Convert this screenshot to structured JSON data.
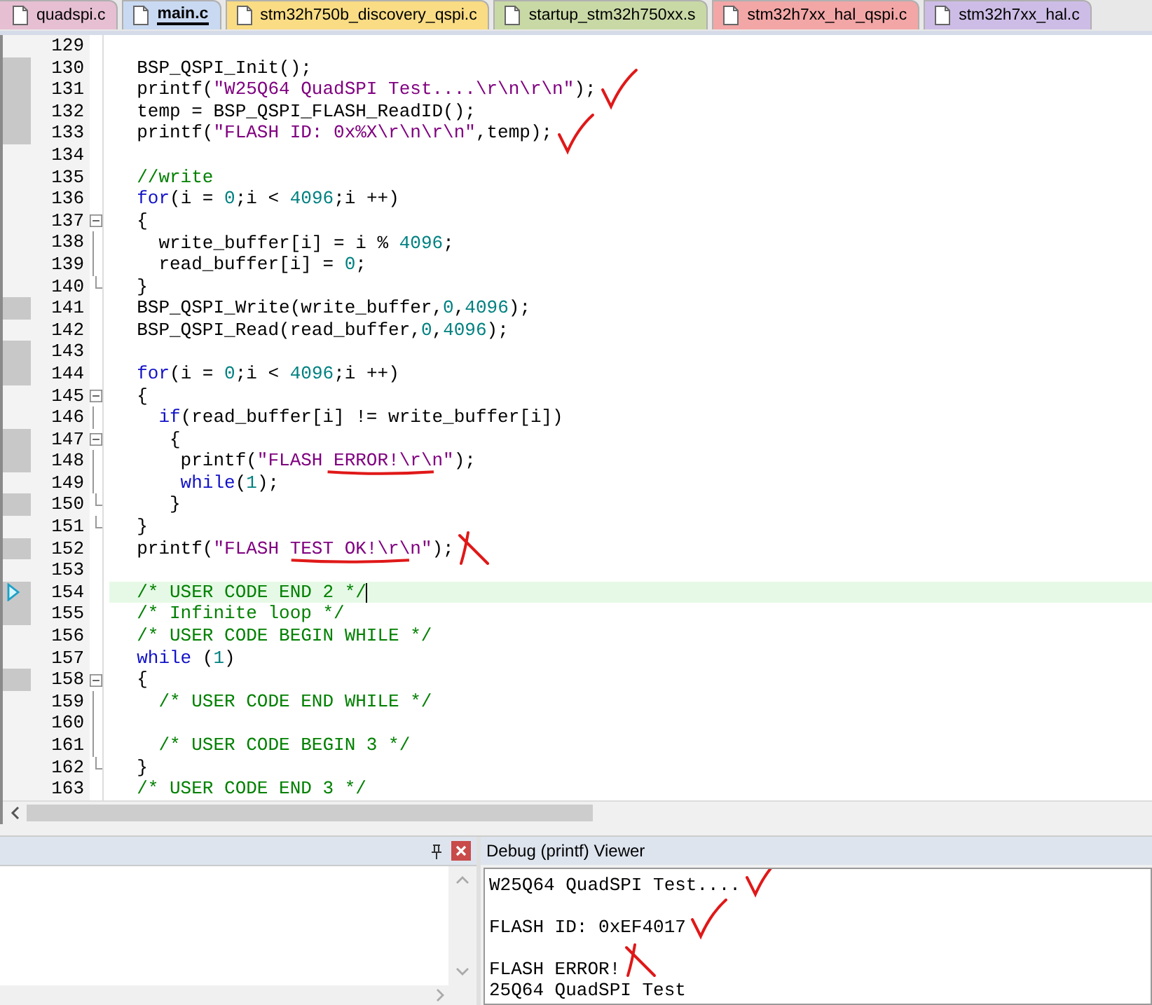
{
  "tabs": [
    {
      "label": "quadspi.c",
      "selected": false,
      "color": "#e6bfd2"
    },
    {
      "label": "main.c",
      "selected": true,
      "color": "#c9d9f2"
    },
    {
      "label": "stm32h750b_discovery_qspi.c",
      "selected": false,
      "color": "#f9dc84"
    },
    {
      "label": "startup_stm32h750xx.s",
      "selected": false,
      "color": "#c9d9a6"
    },
    {
      "label": "stm32h7xx_hal_qspi.c",
      "selected": false,
      "color": "#f2a6a6"
    },
    {
      "label": "stm32h7xx_hal.c",
      "selected": false,
      "color": "#cdbde6"
    }
  ],
  "editor": {
    "lines": [
      {
        "number": "129",
        "executable": false
      },
      {
        "number": "130",
        "executable": true,
        "tokens": [
          {
            "kind": "plain",
            "t": "  BSP_QSPI_Init();"
          }
        ]
      },
      {
        "number": "131",
        "executable": true,
        "tokens": [
          {
            "kind": "plain",
            "t": "  printf("
          },
          {
            "kind": "string",
            "t": "\"W25Q64 QuadSPI Test....\\r\\n\\r\\n\""
          },
          {
            "kind": "plain",
            "t": ");"
          }
        ],
        "marks": [
          {
            "kind": "check"
          }
        ]
      },
      {
        "number": "132",
        "executable": true,
        "tokens": [
          {
            "kind": "plain",
            "t": "  temp = BSP_QSPI_FLASH_ReadID();"
          }
        ]
      },
      {
        "number": "133",
        "executable": true,
        "tokens": [
          {
            "kind": "plain",
            "t": "  printf("
          },
          {
            "kind": "string",
            "t": "\"FLASH ID: 0x%X\\r\\n\\r\\n\""
          },
          {
            "kind": "plain",
            "t": ",temp);"
          }
        ],
        "marks": [
          {
            "kind": "check"
          }
        ]
      },
      {
        "number": "134",
        "executable": false
      },
      {
        "number": "135",
        "executable": false,
        "tokens": [
          {
            "kind": "comment",
            "t": "  //write"
          }
        ]
      },
      {
        "number": "136",
        "executable": false,
        "tokens": [
          {
            "kind": "keyword",
            "t": "  for"
          },
          {
            "kind": "plain",
            "t": "(i = "
          },
          {
            "kind": "number",
            "t": "0"
          },
          {
            "kind": "plain",
            "t": ";i < "
          },
          {
            "kind": "number",
            "t": "4096"
          },
          {
            "kind": "plain",
            "t": ";i ++)"
          }
        ]
      },
      {
        "number": "137",
        "executable": false,
        "fold": {
          "kind": "open"
        },
        "tokens": [
          {
            "kind": "plain",
            "t": "  {"
          }
        ]
      },
      {
        "number": "138",
        "executable": false,
        "fold": {
          "kind": "inner"
        },
        "tokens": [
          {
            "kind": "plain",
            "t": "    write_buffer[i] = i % "
          },
          {
            "kind": "number",
            "t": "4096"
          },
          {
            "kind": "plain",
            "t": ";"
          }
        ]
      },
      {
        "number": "139",
        "executable": false,
        "fold": {
          "kind": "inner"
        },
        "tokens": [
          {
            "kind": "plain",
            "t": "    read_buffer[i] = "
          },
          {
            "kind": "number",
            "t": "0"
          },
          {
            "kind": "plain",
            "t": ";"
          }
        ]
      },
      {
        "number": "140",
        "executable": false,
        "fold": {
          "kind": "end"
        },
        "tokens": [
          {
            "kind": "plain",
            "t": "  }"
          }
        ]
      },
      {
        "number": "141",
        "executable": true,
        "tokens": [
          {
            "kind": "plain",
            "t": "  BSP_QSPI_Write(write_buffer,"
          },
          {
            "kind": "number",
            "t": "0"
          },
          {
            "kind": "plain",
            "t": ","
          },
          {
            "kind": "number",
            "t": "4096"
          },
          {
            "kind": "plain",
            "t": ");"
          }
        ]
      },
      {
        "number": "142",
        "executable": false,
        "tokens": [
          {
            "kind": "plain",
            "t": "  BSP_QSPI_Read(read_buffer,"
          },
          {
            "kind": "number",
            "t": "0"
          },
          {
            "kind": "plain",
            "t": ","
          },
          {
            "kind": "number",
            "t": "4096"
          },
          {
            "kind": "plain",
            "t": ");"
          }
        ]
      },
      {
        "number": "143",
        "executable": true
      },
      {
        "number": "144",
        "executable": true,
        "tokens": [
          {
            "kind": "keyword",
            "t": "  for"
          },
          {
            "kind": "plain",
            "t": "(i = "
          },
          {
            "kind": "number",
            "t": "0"
          },
          {
            "kind": "plain",
            "t": ";i < "
          },
          {
            "kind": "number",
            "t": "4096"
          },
          {
            "kind": "plain",
            "t": ";i ++)"
          }
        ]
      },
      {
        "number": "145",
        "executable": false,
        "fold": {
          "kind": "open"
        },
        "tokens": [
          {
            "kind": "plain",
            "t": "  {"
          }
        ]
      },
      {
        "number": "146",
        "executable": false,
        "fold": {
          "kind": "inner"
        },
        "tokens": [
          {
            "kind": "keyword",
            "t": "    if"
          },
          {
            "kind": "plain",
            "t": "(read_buffer[i] != write_buffer[i])"
          }
        ]
      },
      {
        "number": "147",
        "executable": true,
        "fold": {
          "kind": "open"
        },
        "tokens": [
          {
            "kind": "plain",
            "t": "     {"
          }
        ]
      },
      {
        "number": "148",
        "executable": true,
        "fold": {
          "kind": "inner"
        },
        "tokens": [
          {
            "kind": "plain",
            "t": "      printf("
          },
          {
            "kind": "string",
            "t": "\"FLASH ERROR!\\r\\n\"",
            "underlined": true
          },
          {
            "kind": "plain",
            "t": ");"
          }
        ]
      },
      {
        "number": "149",
        "executable": false,
        "fold": {
          "kind": "inner"
        },
        "tokens": [
          {
            "kind": "keyword",
            "t": "      while"
          },
          {
            "kind": "plain",
            "t": "("
          },
          {
            "kind": "number",
            "t": "1"
          },
          {
            "kind": "plain",
            "t": ");"
          }
        ]
      },
      {
        "number": "150",
        "executable": true,
        "fold": {
          "kind": "end"
        },
        "tokens": [
          {
            "kind": "plain",
            "t": "     }"
          }
        ]
      },
      {
        "number": "151",
        "executable": false,
        "fold": {
          "kind": "end"
        },
        "tokens": [
          {
            "kind": "plain",
            "t": "  }"
          }
        ]
      },
      {
        "number": "152",
        "executable": true,
        "tokens": [
          {
            "kind": "plain",
            "t": "  printf("
          },
          {
            "kind": "string",
            "t": "\"FLASH TEST OK!\\r\\n\"",
            "underlined": true
          },
          {
            "kind": "plain",
            "t": ");"
          }
        ],
        "marks": [
          {
            "kind": "cross"
          }
        ]
      },
      {
        "number": "153",
        "executable": false
      },
      {
        "number": "154",
        "executable": true,
        "current": true,
        "cursor": true,
        "tokens": [
          {
            "kind": "comment",
            "t": "  /* USER CODE END 2 */"
          }
        ]
      },
      {
        "number": "155",
        "executable": true,
        "tokens": [
          {
            "kind": "comment",
            "t": "  /* Infinite loop */"
          }
        ]
      },
      {
        "number": "156",
        "executable": false,
        "tokens": [
          {
            "kind": "comment",
            "t": "  /* USER CODE BEGIN WHILE */"
          }
        ]
      },
      {
        "number": "157",
        "executable": false,
        "tokens": [
          {
            "kind": "keyword",
            "t": "  while"
          },
          {
            "kind": "plain",
            "t": " ("
          },
          {
            "kind": "number",
            "t": "1"
          },
          {
            "kind": "plain",
            "t": ")"
          }
        ]
      },
      {
        "number": "158",
        "executable": true,
        "fold": {
          "kind": "open"
        },
        "tokens": [
          {
            "kind": "plain",
            "t": "  {"
          }
        ]
      },
      {
        "number": "159",
        "executable": false,
        "fold": {
          "kind": "inner"
        },
        "tokens": [
          {
            "kind": "comment",
            "t": "    /* USER CODE END WHILE */"
          }
        ]
      },
      {
        "number": "160",
        "executable": false,
        "fold": {
          "kind": "inner"
        }
      },
      {
        "number": "161",
        "executable": false,
        "fold": {
          "kind": "inner"
        },
        "tokens": [
          {
            "kind": "comment",
            "t": "    /* USER CODE BEGIN 3 */"
          }
        ]
      },
      {
        "number": "162",
        "executable": false,
        "fold": {
          "kind": "end"
        },
        "tokens": [
          {
            "kind": "plain",
            "t": "  }"
          }
        ]
      },
      {
        "number": "163",
        "executable": false,
        "tokens": [
          {
            "kind": "comment",
            "t": "  /* USER CODE END 3 */"
          }
        ]
      }
    ]
  },
  "debug_viewer": {
    "title": "Debug (printf) Viewer",
    "lines": [
      {
        "kind": "text",
        "text": "W25Q64 QuadSPI Test....",
        "marks": [
          {
            "kind": "check"
          }
        ]
      },
      {
        "kind": "blank"
      },
      {
        "kind": "text",
        "text": "FLASH ID: 0xEF4017",
        "marks": [
          {
            "kind": "check"
          }
        ]
      },
      {
        "kind": "blank"
      },
      {
        "kind": "text",
        "text": "FLASH ERROR!",
        "marks": [
          {
            "kind": "cross"
          }
        ]
      },
      {
        "kind": "text",
        "text": "25Q64 QuadSPI Test"
      }
    ]
  }
}
